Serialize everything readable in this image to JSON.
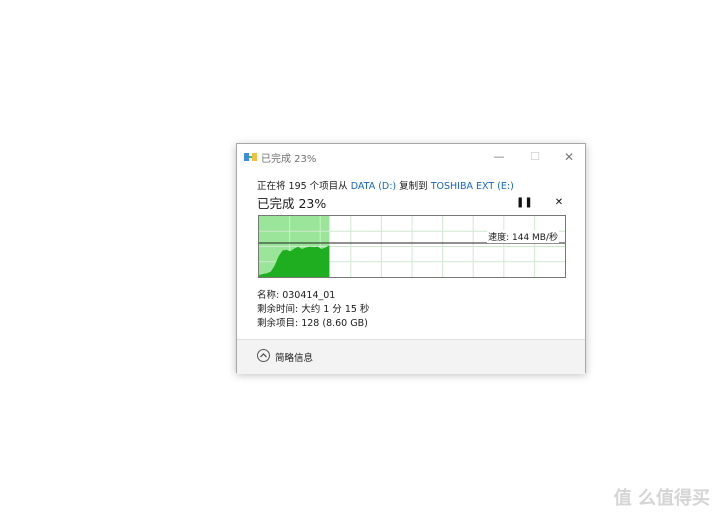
{
  "window": {
    "title": "已完成 23%",
    "minimize_glyph": "—",
    "maximize_glyph": "☐",
    "close_glyph": "✕"
  },
  "copy": {
    "prefix": "正在将 195 个项目从",
    "source": "DATA (D:)",
    "middle": "复制到",
    "destination": "TOSHIBA EXT (E:)"
  },
  "progress": {
    "label": "已完成 23%",
    "percent": 23,
    "pause_glyph": "❚❚",
    "stop_glyph": "✕",
    "fill_color": "#9be59b",
    "chart_color": "#1fae1f"
  },
  "speed": {
    "label": "速度: 144 MB/秒",
    "value": 144
  },
  "details": {
    "name": "名称: 030414_01",
    "time_left": "剩余时间: 大约 1 分 15 秒",
    "items_left": "剩余项目: 128 (8.60 GB)"
  },
  "footer": {
    "toggle_label": "简略信息"
  },
  "watermark": "值 么值得买"
}
